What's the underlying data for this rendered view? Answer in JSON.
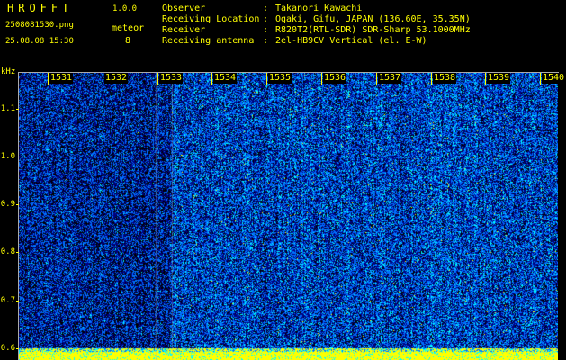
{
  "app": {
    "name": "HROFFT",
    "version": "1.0.0"
  },
  "file": {
    "name": "2508081530.png",
    "datetime": "25.08.08 15:30"
  },
  "detection": {
    "label": "meteor",
    "count": "8"
  },
  "info": {
    "separator": ":",
    "rows": [
      {
        "label": "Observer",
        "value": "Takanori Kawachi"
      },
      {
        "label": "Receiving Location",
        "value": "Ogaki, Gifu, JAPAN (136.60E, 35.35N)"
      },
      {
        "label": "Receiver",
        "value": "R820T2(RTL-SDR) SDR-Sharp 53.1000MHz"
      },
      {
        "label": "Receiving antenna",
        "value": "2el-HB9CV Vertical (el. E-W)"
      }
    ]
  },
  "chart_data": {
    "type": "heatmap",
    "ylabel": "kHz",
    "y_tick_labels": [
      "1.1",
      "1.0",
      "0.9",
      "0.8",
      "0.7",
      "0.6"
    ],
    "y_ticks": [
      1.1,
      1.0,
      0.9,
      0.8,
      0.7,
      0.6
    ],
    "ylim": [
      0.575,
      1.175
    ],
    "x_tick_labels": [
      "1531",
      "1532",
      "1533",
      "1534",
      "1535",
      "1536",
      "1537",
      "1538",
      "1539",
      "1540"
    ],
    "colors": {
      "low": "#000080",
      "mid": "#0070ff",
      "high": "#00ffff",
      "peak": "#ffff00"
    }
  }
}
